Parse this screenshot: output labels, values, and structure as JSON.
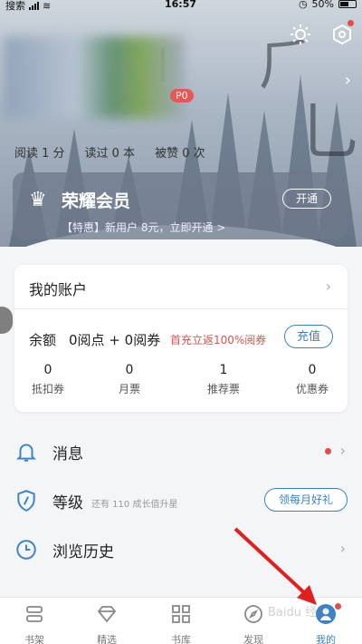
{
  "status_bar": {
    "carrier": "搜索",
    "time": "16:57",
    "battery": "50%"
  },
  "header": {
    "vip_badge": "P0",
    "stats": [
      "阅读 1 分",
      "读过 0 本",
      "被赞 0 次"
    ]
  },
  "member_card": {
    "title": "荣耀会员",
    "promo": "【特惠】新用户 8元，立即开通 >",
    "open_button": "开通"
  },
  "account": {
    "title": "我的账户",
    "balance_label": "余额",
    "balance_value": "0阅点 + 0阅券",
    "promo": "首充立返100%阅券",
    "recharge_button": "充值",
    "items": [
      {
        "value": "0",
        "label": "抵扣券"
      },
      {
        "value": "0",
        "label": "月票"
      },
      {
        "value": "1",
        "label": "推荐票"
      },
      {
        "value": "0",
        "label": "优惠券"
      }
    ]
  },
  "menu": {
    "messages": "消息",
    "level": "等级",
    "level_sub": "还有 110 成长值升星",
    "level_button": "领每月好礼",
    "history": "浏览历史"
  },
  "tabs": [
    {
      "label": "书架",
      "icon": "bookshelf-icon"
    },
    {
      "label": "精选",
      "icon": "diamond-icon"
    },
    {
      "label": "书库",
      "icon": "grid-icon"
    },
    {
      "label": "发现",
      "icon": "compass-icon"
    },
    {
      "label": "我的",
      "icon": "profile-icon"
    }
  ],
  "watermark": "Baidu 经验",
  "colors": {
    "accent": "#3b83c7",
    "alert": "#e84a4a"
  }
}
